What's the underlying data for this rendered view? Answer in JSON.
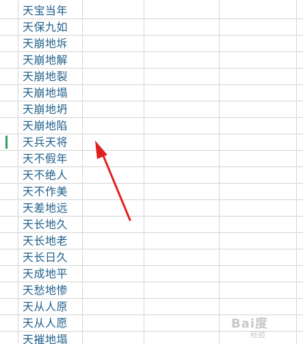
{
  "cells": [
    "天宝当年",
    "天保九如",
    "天崩地坼",
    "天崩地解",
    "天崩地裂",
    "天崩地塌",
    "天崩地坍",
    "天崩地陷",
    "天兵天将",
    "天不假年",
    "天不绝人",
    "天不作美",
    "天差地远",
    "天长地久",
    "天长地老",
    "天长日久",
    "天成地平",
    "天愁地惨",
    "天从人原",
    "天从人愿",
    "天摧地塌"
  ],
  "selected_row_index": 8,
  "arrow": {
    "color": "#e02020"
  },
  "watermark": {
    "logo": "Bai度",
    "sub": "经验"
  }
}
